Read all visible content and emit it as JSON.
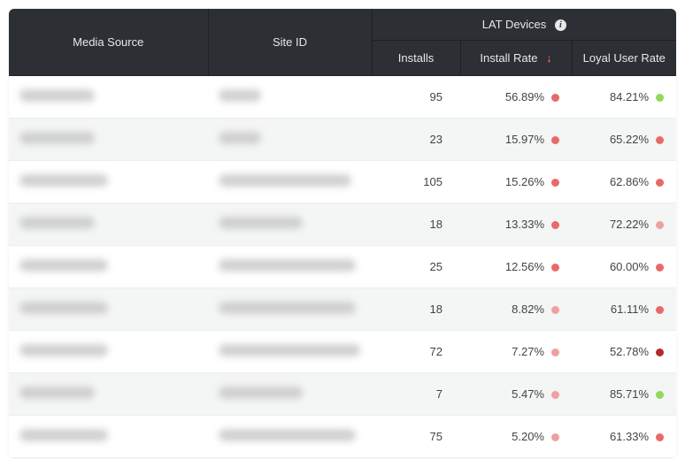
{
  "colors": {
    "green": "#90d95a",
    "red_mid": "#e76a6a",
    "red_light": "#efa0a0",
    "red_dark": "#b62b2b"
  },
  "header": {
    "media_source": "Media Source",
    "site_id": "Site ID",
    "group_label": "LAT Devices",
    "installs": "Installs",
    "install_rate": "Install Rate",
    "loyal_user_rate": "Loyal User Rate",
    "sort_arrow": "↓"
  },
  "rows": [
    {
      "media_blur_w": 85,
      "site_blur_w": 48,
      "installs": "95",
      "install_rate": "56.89%",
      "install_dot": "red_mid",
      "loyal_rate": "84.21%",
      "loyal_dot": "green"
    },
    {
      "media_blur_w": 85,
      "site_blur_w": 48,
      "installs": "23",
      "install_rate": "15.97%",
      "install_dot": "red_mid",
      "loyal_rate": "65.22%",
      "loyal_dot": "red_mid"
    },
    {
      "media_blur_w": 100,
      "site_blur_w": 150,
      "installs": "105",
      "install_rate": "15.26%",
      "install_dot": "red_mid",
      "loyal_rate": "62.86%",
      "loyal_dot": "red_mid"
    },
    {
      "media_blur_w": 85,
      "site_blur_w": 95,
      "installs": "18",
      "install_rate": "13.33%",
      "install_dot": "red_mid",
      "loyal_rate": "72.22%",
      "loyal_dot": "red_light"
    },
    {
      "media_blur_w": 100,
      "site_blur_w": 155,
      "installs": "25",
      "install_rate": "12.56%",
      "install_dot": "red_mid",
      "loyal_rate": "60.00%",
      "loyal_dot": "red_mid"
    },
    {
      "media_blur_w": 100,
      "site_blur_w": 155,
      "installs": "18",
      "install_rate": "8.82%",
      "install_dot": "red_light",
      "loyal_rate": "61.11%",
      "loyal_dot": "red_mid"
    },
    {
      "media_blur_w": 100,
      "site_blur_w": 160,
      "installs": "72",
      "install_rate": "7.27%",
      "install_dot": "red_light",
      "loyal_rate": "52.78%",
      "loyal_dot": "red_dark"
    },
    {
      "media_blur_w": 85,
      "site_blur_w": 95,
      "installs": "7",
      "install_rate": "5.47%",
      "install_dot": "red_light",
      "loyal_rate": "85.71%",
      "loyal_dot": "green"
    },
    {
      "media_blur_w": 100,
      "site_blur_w": 155,
      "installs": "75",
      "install_rate": "5.20%",
      "install_dot": "red_light",
      "loyal_rate": "61.33%",
      "loyal_dot": "red_mid"
    }
  ]
}
